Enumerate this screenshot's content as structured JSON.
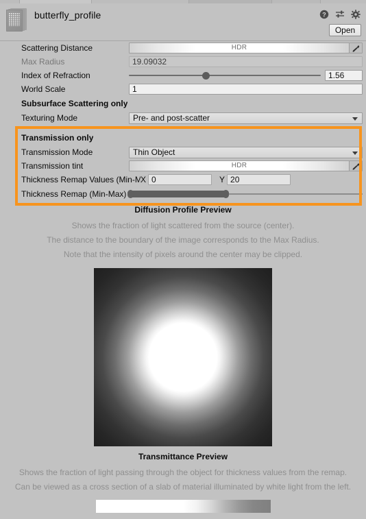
{
  "window": {
    "asset_name": "butterfly_profile",
    "asset_icon": "diffusion-profile-asset-icon",
    "open_button": "Open",
    "header_icons": [
      {
        "name": "help-icon",
        "glyph": "?"
      },
      {
        "name": "preset-icon",
        "glyph": "sliders"
      },
      {
        "name": "settings-gear-icon",
        "glyph": "gear"
      }
    ]
  },
  "properties": {
    "scattering_distance": {
      "label": "Scattering Distance",
      "type": "color-hdr",
      "tag": "HDR",
      "eyedropper": "eyedropper-icon"
    },
    "max_radius": {
      "label": "Max Radius",
      "value": "19.09032",
      "readonly": true
    },
    "index_of_refraction": {
      "label": "Index of Refraction",
      "value": "1.56",
      "slider_percent": 40
    },
    "world_scale": {
      "label": "World Scale",
      "value": "1"
    }
  },
  "subsurface_section": {
    "title": "Subsurface Scattering only",
    "texturing_mode": {
      "label": "Texturing Mode",
      "value": "Pre- and post-scatter"
    }
  },
  "transmission_section": {
    "title": "Transmission only",
    "highlighted": true,
    "highlight_color": "#f7941e",
    "transmission_mode": {
      "label": "Transmission Mode",
      "value": "Thin Object"
    },
    "transmission_tint": {
      "label": "Transmission tint",
      "type": "color-hdr",
      "tag": "HDR",
      "eyedropper": "eyedropper-icon"
    },
    "thickness_remap_values": {
      "label": "Thickness Remap Values (Min-M",
      "x_axis": "X",
      "x_value": "0",
      "y_axis": "Y",
      "y_value": "20"
    },
    "thickness_remap_slider": {
      "label": "Thickness Remap (Min-Max)",
      "min_percent": 0,
      "max_percent": 42
    }
  },
  "diffusion_preview": {
    "title": "Diffusion Profile Preview",
    "note1": "Shows the fraction of light scattered from the source (center).",
    "note2": "The distance to the boundary of the image corresponds to the Max Radius.",
    "note3": "Note that the intensity of pixels around the center may be clipped."
  },
  "transmittance_preview": {
    "title": "Transmittance Preview",
    "note1": "Shows the fraction of light passing through the object for thickness values from the remap.",
    "note2": "Can be viewed as a cross section of a slab of material illuminated by white light from the left."
  }
}
